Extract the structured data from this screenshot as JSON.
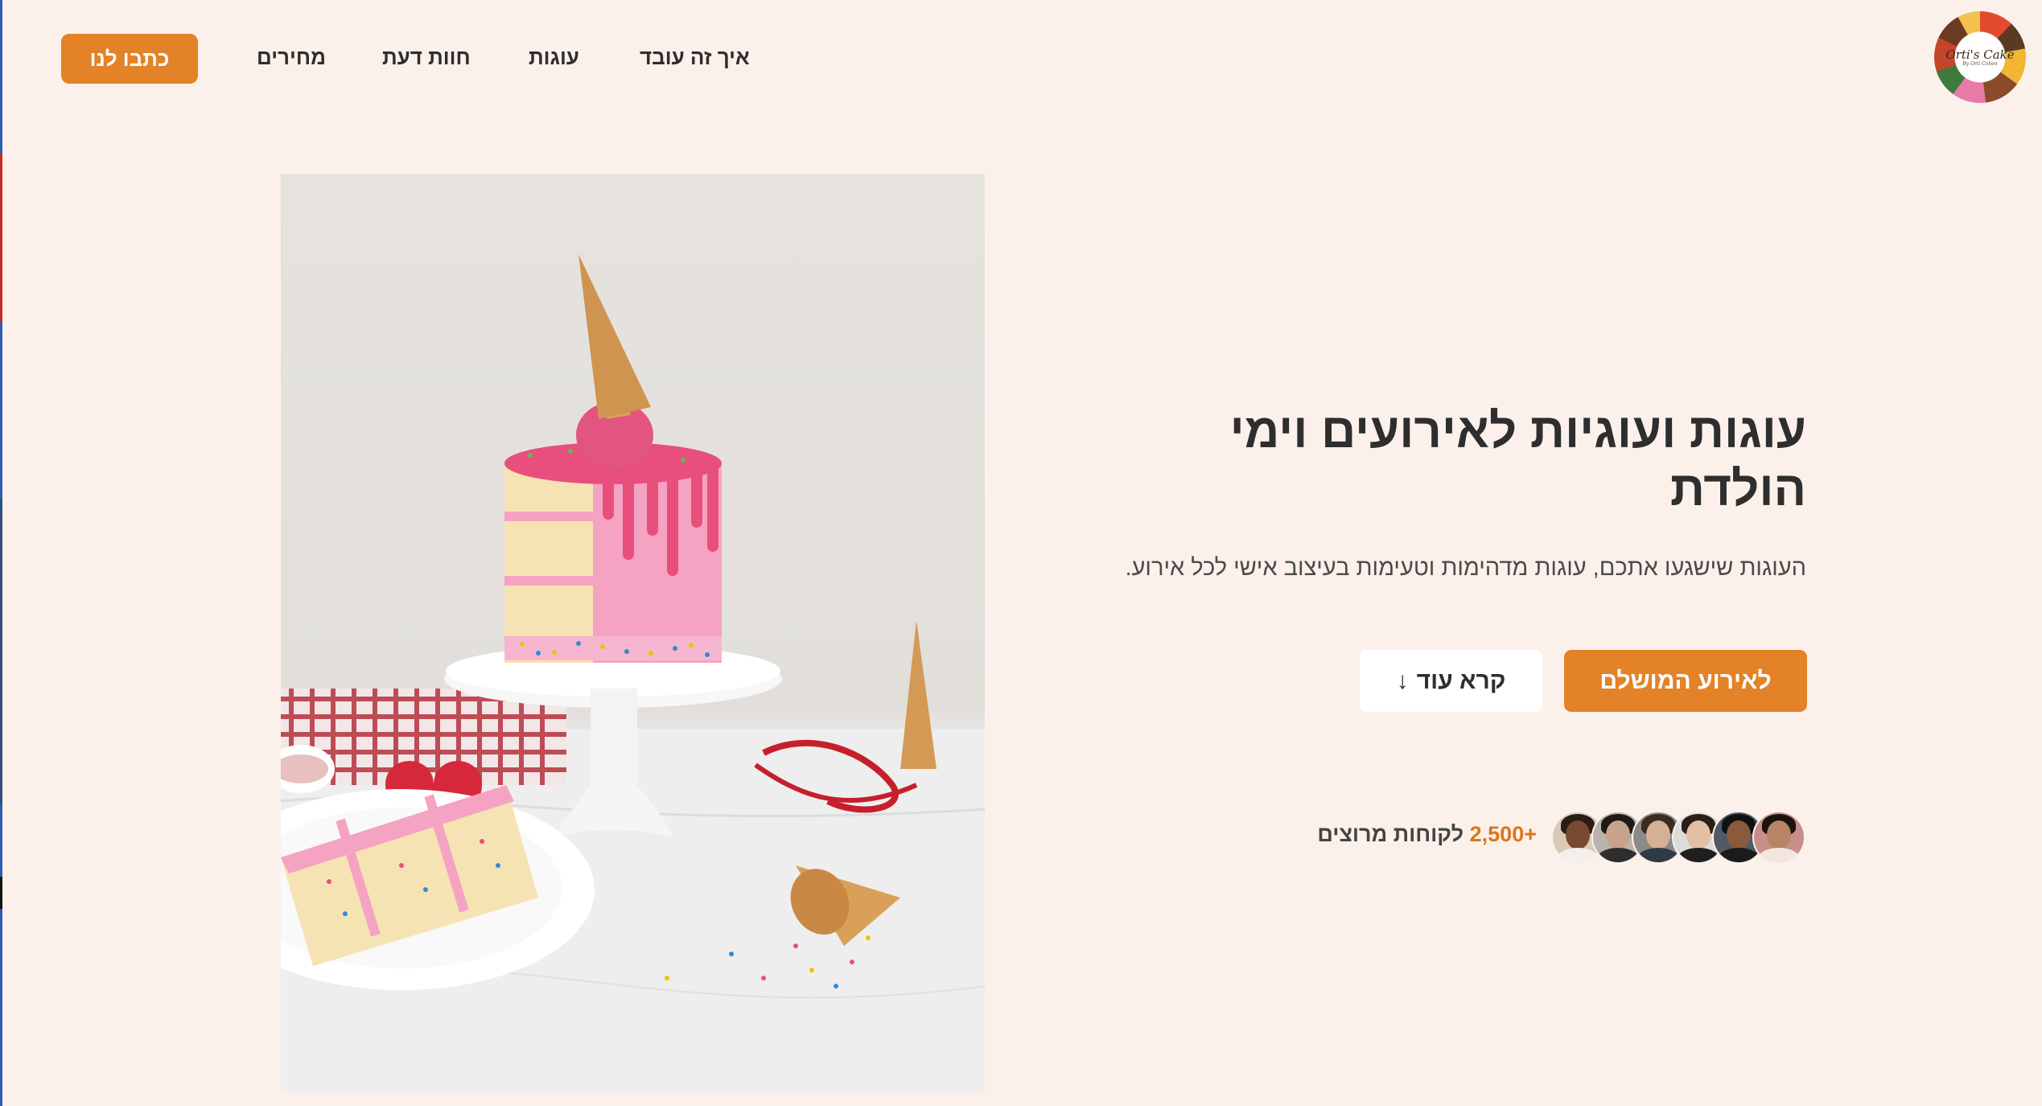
{
  "header": {
    "logo_text": "Orti's Cake",
    "logo_sub": "By Orti Cohen",
    "nav": [
      {
        "label": "איך זה עובד"
      },
      {
        "label": "עוגות"
      },
      {
        "label": "חוות דעת"
      },
      {
        "label": "מחירים"
      }
    ],
    "cta_label": "כתבו לנו"
  },
  "hero": {
    "title": "עוגות ועוגיות לאירועים וימי הולדת",
    "subtitle": "העוגות שישגעו אתכם, עוגות מדהימות וטעימות בעיצוב אישי לכל אירוע.",
    "primary_button": "לאירוע המושלם",
    "secondary_button": "קרא עוד",
    "arrow_icon": "↓",
    "customers_count": "+2,500",
    "customers_label": "לקוחות מרוצים",
    "image_alt": "pink drip cake with ice cream cone"
  },
  "colors": {
    "background": "#fcf1ea",
    "accent": "#e38226",
    "text": "#2e2e2e"
  }
}
